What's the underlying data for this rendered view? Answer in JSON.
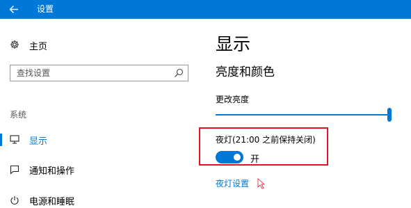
{
  "window": {
    "title": "设置",
    "back_icon": "arrow-left-icon",
    "accent_color": "#0078d7"
  },
  "sidebar": {
    "home": {
      "label": "主页",
      "icon": "gear-icon"
    },
    "search": {
      "placeholder": "查找设置",
      "icon": "search-icon"
    },
    "section_label": "系统",
    "items": [
      {
        "label": "显示",
        "icon": "monitor-icon",
        "selected": true
      },
      {
        "label": "通知和操作",
        "icon": "message-icon",
        "selected": false
      },
      {
        "label": "电源和睡眠",
        "icon": "power-icon",
        "selected": false
      }
    ]
  },
  "main": {
    "page_title": "显示",
    "section_title": "亮度和颜色",
    "brightness": {
      "label": "更改亮度",
      "value": 1.0
    },
    "night_light": {
      "label": "夜灯(21:00 之前保持关闭)",
      "toggle_on": true,
      "state_text": "开",
      "highlight_color": "#e81123"
    },
    "night_light_settings_link": "夜灯设置"
  }
}
